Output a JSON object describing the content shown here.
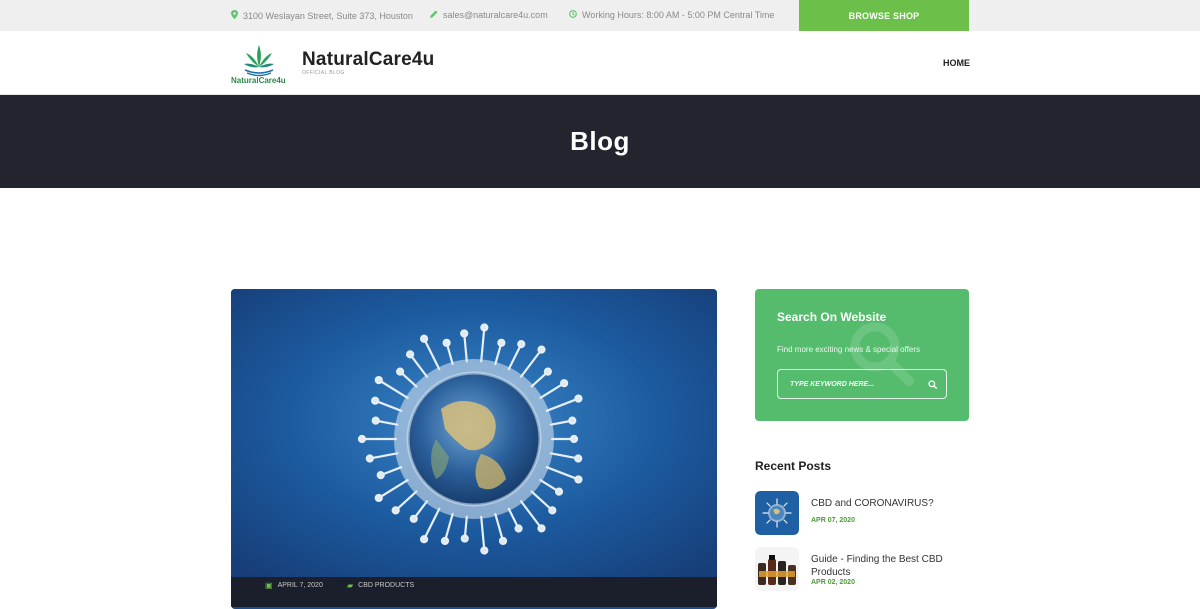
{
  "topbar": {
    "address": "3100 Weslayan Street, Suite 373, Houston",
    "email": "sales@naturalcare4u.com",
    "hours": "Working Hours: 8:00 AM - 5:00 PM Central Time",
    "browse_label": "BROWSE SHOP",
    "icons": [
      "map-marker-icon",
      "pencil-icon",
      "clock-icon"
    ],
    "accent": "#6cc04a"
  },
  "header": {
    "logo_text": "NaturalCare4u",
    "brand": "NaturalCare4u",
    "tagline": "OFFICIAL BLOG",
    "nav": [
      {
        "label": "HOME"
      }
    ]
  },
  "hero": {
    "title": "Blog",
    "background": "#22252d"
  },
  "post": {
    "image_alt_icon": "coronavirus-globe-image",
    "meta": [
      {
        "icon": "calendar-icon",
        "text": "APRIL 7, 2020"
      },
      {
        "icon": "folder-icon",
        "text": "CBD PRODUCTS"
      }
    ]
  },
  "sidebar": {
    "search": {
      "title": "Search On Website",
      "subtitle": "Find more exciting news & special offers",
      "placeholder": "TYPE KEYWORD HERE...",
      "background": "#55bc6e"
    },
    "recent": {
      "title": "Recent Posts",
      "items": [
        {
          "title": "CBD and CORONAVIRUS?",
          "date": "APR 07, 2020"
        },
        {
          "title": "Guide - Finding the Best CBD Products",
          "date": "APR 02, 2020"
        }
      ]
    }
  }
}
